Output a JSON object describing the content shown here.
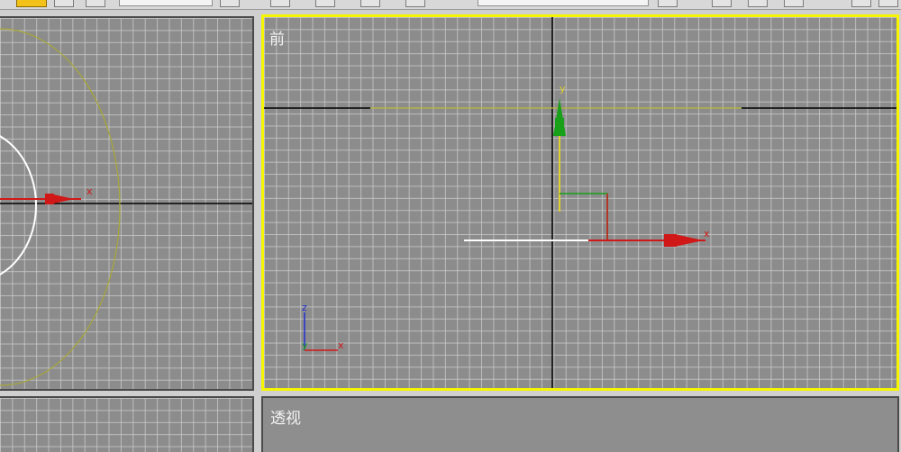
{
  "viewports": {
    "top": {
      "label": ""
    },
    "front": {
      "label": "前",
      "active": true
    },
    "left": {
      "label": ""
    },
    "perspective": {
      "label": "透视"
    }
  },
  "axis_labels": {
    "x": "x",
    "y": "y",
    "z": "z"
  },
  "colors": {
    "viewport_bg": "#8c8c8c",
    "grid_line": "#cdcdcd",
    "active_border": "#f5f500",
    "axis_x": "#d01818",
    "axis_y": "#18a018",
    "axis_z": "#2030d0",
    "selection_line": "#b8b83a"
  },
  "icons": {
    "toolbar": [
      "select-tool-icon",
      "circle-tool-icon",
      "move-tool-icon",
      "snap-icon",
      "named-selection-field",
      "render-icon",
      "material-icon"
    ]
  }
}
